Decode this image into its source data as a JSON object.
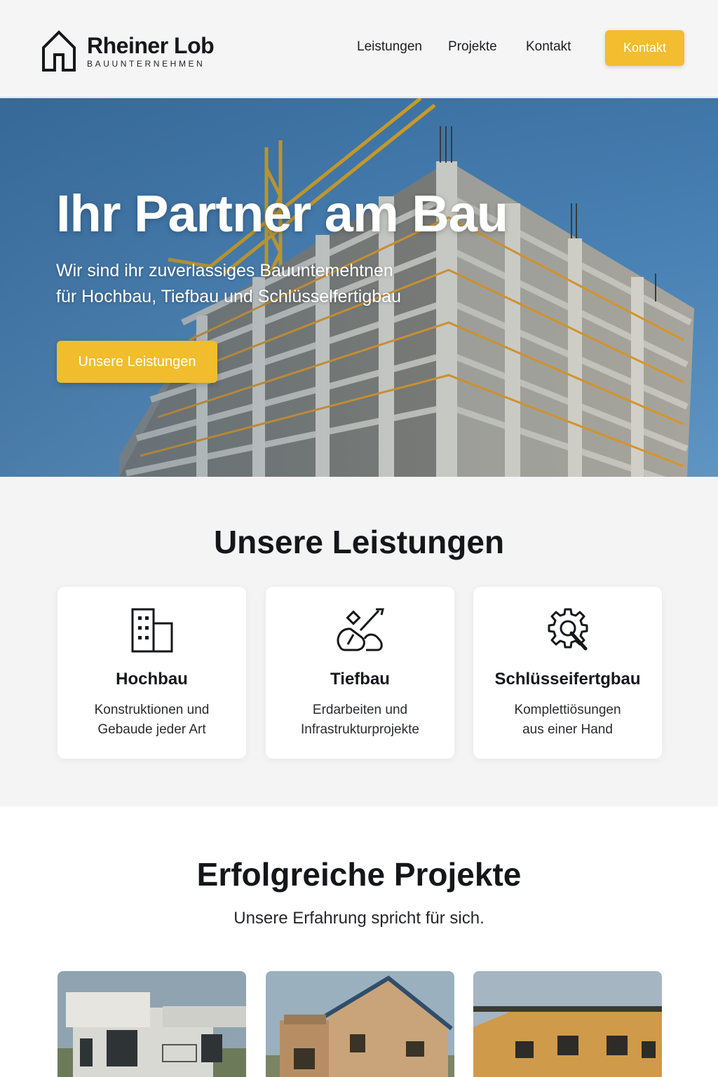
{
  "brand": {
    "name": "Rheiner Lob",
    "tagline": "BAUUNTERNEHMEN"
  },
  "nav": {
    "items": [
      {
        "label": "Leistungen"
      },
      {
        "label": "Projekte"
      },
      {
        "label": "Kontakt"
      }
    ],
    "cta_label": "Kontakt"
  },
  "hero": {
    "title": "Ihr Partner am Bau",
    "subtitle_line1": "Wir sind ihr zuverlassiges Bauuntemehtnen",
    "subtitle_line2": "für Hochbau, Tiefbau und Schlüsselfertigbau",
    "button_label": "Unsere Leistungen"
  },
  "services": {
    "title": "Unsere Leistungen",
    "cards": [
      {
        "icon": "building-icon",
        "title": "Hochbau",
        "desc_line1": "Konstruktionen und",
        "desc_line2": "Gebaude jeder Art"
      },
      {
        "icon": "excavation-shovel-icon",
        "title": "Tiefbau",
        "desc_line1": "Erdarbeiten und",
        "desc_line2": "Infrastrukturprojekte"
      },
      {
        "icon": "gear-wrench-icon",
        "title": "Schlüsseifertgbau",
        "desc_line1": "Komplettiösungen",
        "desc_line2": "aus einer Hand"
      }
    ]
  },
  "projects": {
    "title": "Erfolgreiche Projekte",
    "subtitle": "Unsere Erfahrung spricht für sich.",
    "items": [
      {
        "image": "modern-white-house-photo"
      },
      {
        "image": "wooden-house-photo"
      },
      {
        "image": "orange-clad-building-photo"
      }
    ]
  },
  "colors": {
    "accent": "#f2bd2e",
    "sky": "#4a82b5",
    "text": "#15161a"
  }
}
